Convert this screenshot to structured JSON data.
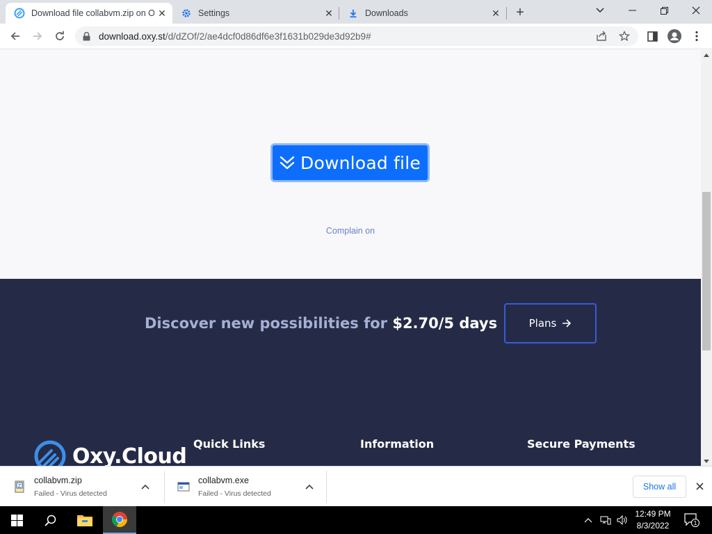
{
  "browser": {
    "tabs": [
      {
        "title": "Download file collabvm.zip on O",
        "icon": "oxycloud-favicon",
        "active": true
      },
      {
        "title": "Settings",
        "icon": "gear-icon",
        "active": false
      },
      {
        "title": "Downloads",
        "icon": "download-icon",
        "active": false
      }
    ],
    "url": {
      "host": "download.oxy.st",
      "path": "/d/dZOf/2/ae4dcf0d86df6e3f1631b029de3d92b9#"
    }
  },
  "page": {
    "download_button_label": "Download file",
    "complain_link": "Complain on",
    "promo": {
      "lead": "Discover new possibilities for",
      "price": "$2.70/5 days",
      "plans_button": "Plans"
    },
    "footer": {
      "logo_text": "Oxy.Cloud",
      "headings": [
        "Quick Links",
        "Information",
        "Secure Payments"
      ]
    }
  },
  "download_shelf": {
    "items": [
      {
        "name": "collabvm.zip",
        "status": "Failed - Virus detected",
        "icon": "zip-file-icon"
      },
      {
        "name": "collabvm.exe",
        "status": "Failed - Virus detected",
        "icon": "exe-file-icon"
      }
    ],
    "show_all": "Show all"
  },
  "taskbar": {
    "time": "12:49 PM",
    "date": "8/3/2022",
    "notification_count": "1"
  },
  "colors": {
    "accent_button": "#0d6efd",
    "promo_background": "#252b47",
    "link": "#6a7fc7"
  }
}
